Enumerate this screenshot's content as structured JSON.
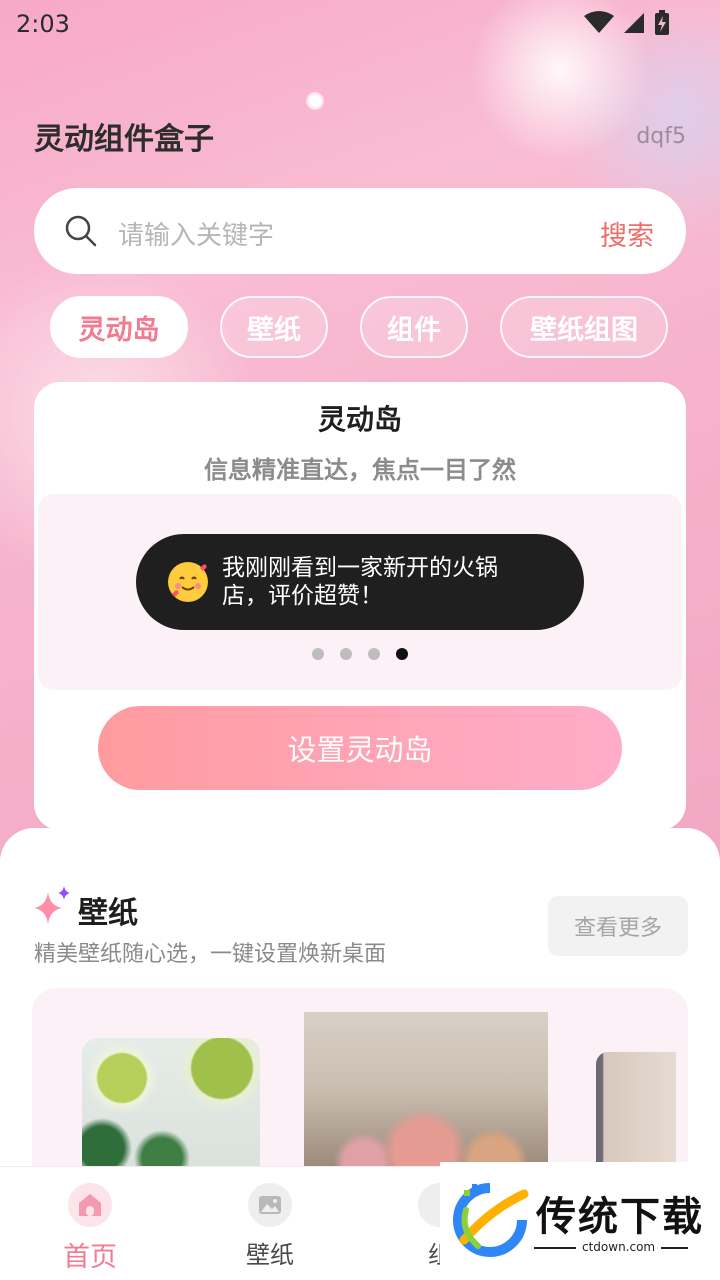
{
  "status_bar": {
    "time": "2:03",
    "icons": [
      "wifi-icon",
      "signal-icon",
      "battery-charging-icon"
    ]
  },
  "header": {
    "title": "灵动组件盒子",
    "user_id": "dqf5"
  },
  "search": {
    "placeholder": "请输入关键字",
    "button_label": "搜索",
    "icon": "search-icon"
  },
  "category_tabs": [
    {
      "label": "灵动岛",
      "active": true
    },
    {
      "label": "壁纸",
      "active": false
    },
    {
      "label": "组件",
      "active": false
    },
    {
      "label": "壁纸组图",
      "active": false
    }
  ],
  "feature_card": {
    "title": "灵动岛",
    "subtitle": "信息精准直达，焦点一目了然",
    "island_message": "我刚刚看到一家新开的火锅店，评价超赞！",
    "island_icon": "smiling-face-with-hearts-icon",
    "carousel": {
      "count": 4,
      "active_index": 3
    },
    "action_label": "设置灵动岛"
  },
  "wallpaper_section": {
    "icon": "sparkle-icon",
    "title": "壁纸",
    "subtitle": "精美壁纸随心选，一键设置焕新桌面",
    "more_label": "查看更多",
    "thumbnails": [
      "kiwi-lemon-water-wallpaper",
      "rose-tea-glass-wallpaper",
      "beige-minimal-wallpaper"
    ]
  },
  "bottom_nav": [
    {
      "label": "首页",
      "icon": "home-icon",
      "active": true
    },
    {
      "label": "壁纸",
      "icon": "image-icon",
      "active": false
    },
    {
      "label": "组",
      "icon": "widget-icon",
      "active": false
    }
  ],
  "watermark": {
    "brand": "传统下载",
    "url": "ctdown.com"
  },
  "colors": {
    "accent": "#f27b92",
    "search_button": "#f26b6b",
    "island_bg": "#1f1f1f",
    "button_gradient_start": "#ff9b9f",
    "button_gradient_end": "#ffadca"
  }
}
